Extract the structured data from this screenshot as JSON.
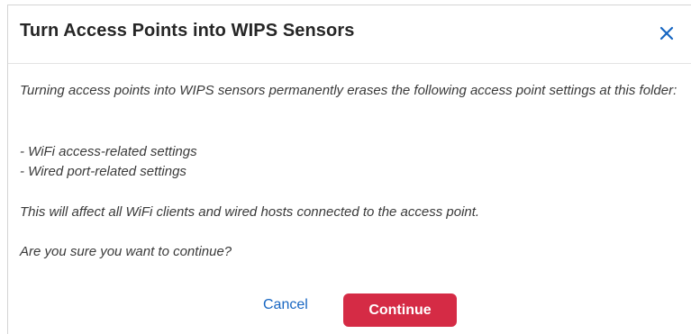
{
  "dialog": {
    "title": "Turn Access Points into WIPS Sensors",
    "close_icon": "close-icon",
    "body": {
      "intro": "Turning access points into WIPS sensors permanently erases the following access point settings at this folder:",
      "items": [
        "- WiFi access-related settings",
        "- Wired port-related settings"
      ],
      "affect": "This will affect all WiFi clients and wired hosts connected to the access point.",
      "confirm": "Are you sure you want to continue?"
    },
    "buttons": {
      "cancel_label": "Cancel",
      "continue_label": "Continue"
    }
  },
  "colors": {
    "title": "#262626",
    "body_text": "#3a3a3a",
    "link_blue": "#1766c2",
    "primary_red": "#d52b45"
  }
}
